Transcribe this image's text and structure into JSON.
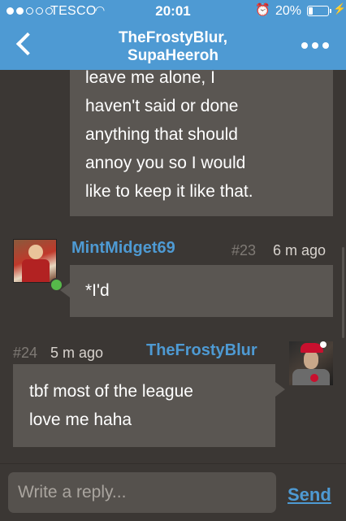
{
  "status_bar": {
    "carrier": "TESCO",
    "time": "20:01",
    "battery": "20%",
    "battery_level": 0.2,
    "signal_bars_filled": 2,
    "signal_bars_total": 5
  },
  "header": {
    "title_line1": "TheFrostyBlur,",
    "title_line2": "SupaHeeroh",
    "back_icon": "chevron-left-icon",
    "more_icon": "more-dots-icon",
    "color": "#4e9ad3"
  },
  "messages": [
    {
      "lines": [
        "leave me alone, I",
        "haven't said or done",
        "anything that should",
        "annoy you so I would",
        "like to keep it like that."
      ]
    },
    {
      "user": "MintMidget69",
      "number": "#23",
      "ago": "6 m ago",
      "text": "*I'd",
      "online": true,
      "online_color": "#56b94a"
    },
    {
      "user": "TheFrostyBlur",
      "number": "#24",
      "ago": "5 m ago",
      "lines": [
        "tbf most of the league",
        "love me haha"
      ]
    }
  ],
  "reply": {
    "placeholder": "Write a reply...",
    "send_label": "Send"
  }
}
